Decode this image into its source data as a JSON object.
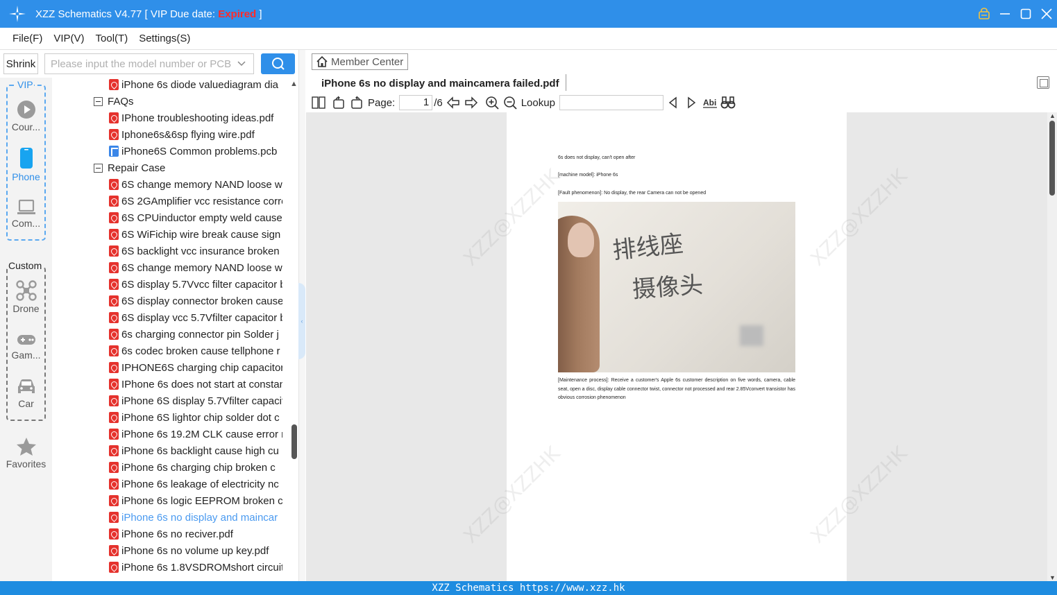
{
  "app": {
    "title_prefix": "XZZ Schematics V4.77 [ VIP Due date: ",
    "title_status": "Expired",
    "title_suffix": " ]",
    "accent_color": "#2f8fe9",
    "status_color": "#ff2a2a"
  },
  "window_buttons": [
    "lock-icon",
    "minimize-icon",
    "maximize-icon",
    "close-icon"
  ],
  "menu": [
    "File(F)",
    "VIP(V)",
    "Tool(T)",
    "Settings(S)"
  ],
  "search": {
    "shrink_label": "Shrink",
    "placeholder": "Please input the model number or PCB"
  },
  "sidebar": {
    "vip_group_label": "VIP",
    "custom_group_label": "Custom",
    "items": [
      {
        "label": "Cour...",
        "icon": "play-icon"
      },
      {
        "label": "Phone",
        "icon": "phone-icon",
        "active": true
      },
      {
        "label": "Com...",
        "icon": "laptop-icon"
      },
      {
        "label": "Drone",
        "icon": "drone-icon"
      },
      {
        "label": "Gam...",
        "icon": "gamepad-icon"
      },
      {
        "label": "Car",
        "icon": "car-icon"
      },
      {
        "label": "Favorites",
        "icon": "star-icon"
      }
    ]
  },
  "tree": {
    "items": [
      {
        "text": "iPhone 6s diode valuediagram dia",
        "type": "pdf"
      },
      {
        "text": "FAQs",
        "type": "folder"
      },
      {
        "text": "IPhone troubleshooting ideas.pdf",
        "type": "pdf"
      },
      {
        "text": "Iphone6s&6sp flying wire.pdf",
        "type": "pdf"
      },
      {
        "text": "iPhone6S Common problems.pcb",
        "type": "pcb"
      },
      {
        "text": "Repair Case",
        "type": "folder"
      },
      {
        "text": "6S  change memory NAND loose w",
        "type": "pdf"
      },
      {
        "text": "6S 2GAmplifier vcc resistance corro",
        "type": "pdf"
      },
      {
        "text": "6S CPUinductor empty weld cause",
        "type": "pdf"
      },
      {
        "text": "6S WiFichip wire break  cause sign",
        "type": "pdf"
      },
      {
        "text": "6S backlight vcc insurance broken",
        "type": "pdf"
      },
      {
        "text": "6S change memory NAND loose w",
        "type": "pdf"
      },
      {
        "text": "6S display 5.7Vvcc filter capacitor b",
        "type": "pdf"
      },
      {
        "text": "6S display connector broken cause",
        "type": "pdf"
      },
      {
        "text": "6S display vcc 5.7Vfilter capacitor b",
        "type": "pdf"
      },
      {
        "text": "6s charging connector pin Solder j",
        "type": "pdf"
      },
      {
        "text": "6s codec broken cause tellphone r",
        "type": "pdf"
      },
      {
        "text": "IPHONE6S charging chip capacitor",
        "type": "pdf"
      },
      {
        "text": "IPhone 6s does not start at constan",
        "type": "pdf"
      },
      {
        "text": "iPhone 6S display 5.7Vfilter capacit",
        "type": "pdf"
      },
      {
        "text": "iPhone 6S lightor chip solder dot c",
        "type": "pdf"
      },
      {
        "text": "iPhone 6s  19.2M CLK cause error r",
        "type": "pdf"
      },
      {
        "text": "iPhone 6s  backlight cause high cu",
        "type": "pdf"
      },
      {
        "text": "iPhone 6s  charging chip broken c",
        "type": "pdf"
      },
      {
        "text": "iPhone 6s  leakage of electricity nc",
        "type": "pdf"
      },
      {
        "text": "iPhone 6s  logic EEPROM broken c",
        "type": "pdf"
      },
      {
        "text": "iPhone 6s  no display and maincar",
        "type": "pdf",
        "selected": true
      },
      {
        "text": "iPhone 6s  no reciver.pdf",
        "type": "pdf"
      },
      {
        "text": "iPhone 6s  no volume up key.pdf",
        "type": "pdf"
      },
      {
        "text": "iPhone 6s 1.8VSDROMshort circuit",
        "type": "pdf"
      }
    ]
  },
  "viewer": {
    "member_center": "Member Center",
    "document_title": "iPhone 6s  no display and maincamera failed.pdf",
    "page_label": "Page:",
    "current_page": "1",
    "page_total": "/6",
    "lookup_label": "Lookup",
    "lookup_value": "",
    "watermark": "XZZ@XZZHK"
  },
  "document": {
    "line1": "6s does not display, can't open after",
    "line2": "[machine model]: iPhone 6s",
    "line3": "[Fault phenomenon]: No display, the rear Camera can not be opened",
    "handwriting_line1": "排线座",
    "handwriting_line2": "摄像头",
    "maintenance": "[Maintenance process]: Receive a customer's Apple 6s customer description on five words, camera, cable seat, open a disc, display cable connector twist, connector not processed and rear 2.85Vconvert transistor has obvious corrosion phenomenon"
  },
  "statusbar": {
    "text": "XZZ Schematics https://www.xzz.hk"
  }
}
